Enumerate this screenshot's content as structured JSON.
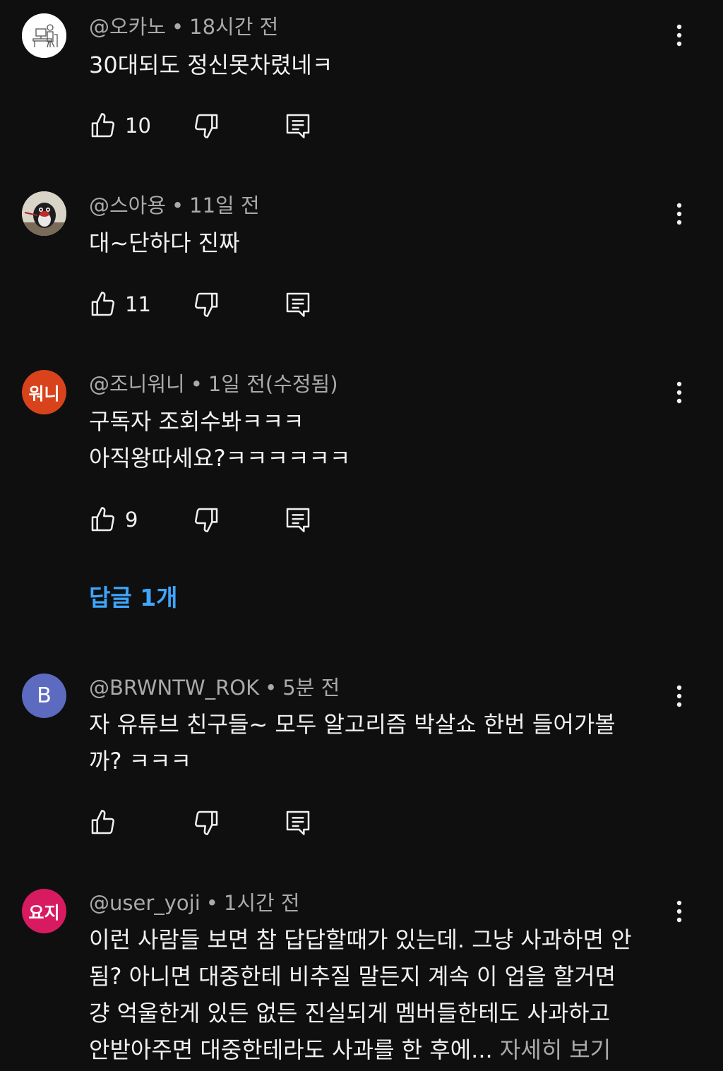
{
  "comments": [
    {
      "avatar_type": "image",
      "avatar_bg": "#ffffff",
      "author": "@오카노",
      "time": "18시간 전",
      "lines": [
        "30대되도 정신못차렸네ㅋ"
      ],
      "likes": "10"
    },
    {
      "avatar_type": "image",
      "avatar_bg": "#d9d4c8",
      "author": "@스아용",
      "time": "11일 전",
      "lines": [
        "대~단하다 진짜"
      ],
      "likes": "11"
    },
    {
      "avatar_type": "text",
      "avatar_bg": "#d8431c",
      "avatar_text": "워니",
      "author": "@조니워니",
      "time": "1일 전(수정됨)",
      "lines": [
        "구독자 조회수봐ㅋㅋㅋ",
        "아직왕따세요?ㅋㅋㅋㅋㅋㅋ"
      ],
      "likes": "9"
    },
    {
      "avatar_type": "text",
      "avatar_bg": "#5c6bc0",
      "avatar_text": "B",
      "author": "@BRWNTW_ROK",
      "time": "5분 전",
      "lines": [
        "자 유튜브 친구들~ 모두 알고리즘 박살쇼 한번 들어가볼",
        "까? ㅋㅋㅋ"
      ],
      "likes": ""
    },
    {
      "avatar_type": "text",
      "avatar_bg": "#d81b60",
      "avatar_text": "요지",
      "author": "@user_yoji",
      "time": "1시간 전",
      "lines": [
        "이런 사람들 보면 참 답답할때가 있는데. 그냥 사과하면 안",
        "됨? 아니면 대중한테 비추질 말든지 계속 이 업을 할거면",
        "걍 억울한게 있든 없든 진실되게 멤버들한테도 사과하고",
        "안받아주면 대중한테라도 사과를 한 후에..."
      ],
      "more_label": "자세히 보기"
    }
  ],
  "replies_link": "답글 1개",
  "icons": {
    "like": "thumbs-up-icon",
    "dislike": "thumbs-down-icon",
    "reply": "reply-icon",
    "more": "more-vert-icon"
  },
  "colors": {
    "background": "#0f0f0f",
    "text": "#f1f1f1",
    "secondary": "#aaaaaa",
    "link": "#3ea6ff"
  }
}
